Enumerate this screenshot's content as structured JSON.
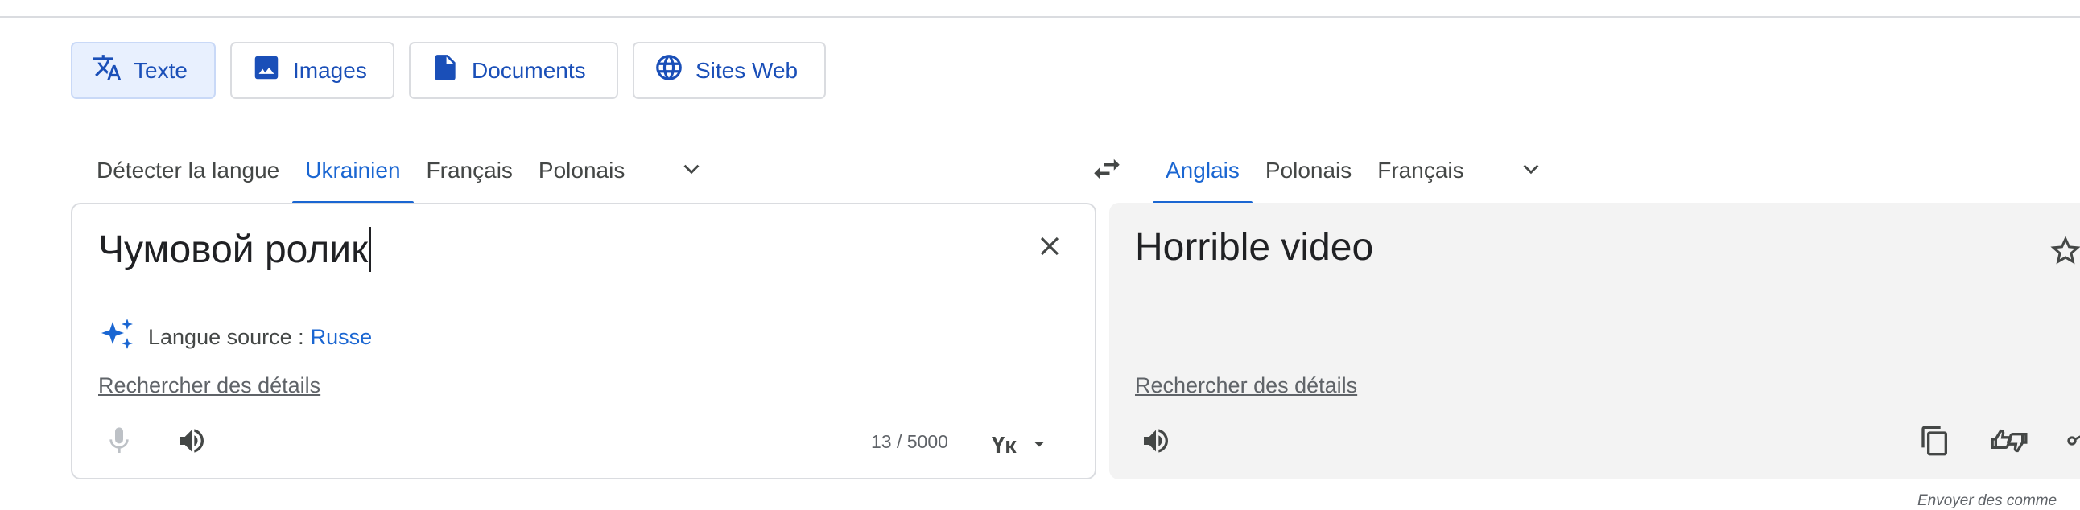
{
  "mode_tabs": {
    "text": "Texte",
    "images": "Images",
    "documents": "Documents",
    "websites": "Sites Web"
  },
  "source_langs": {
    "detect": "Détecter la langue",
    "items": [
      "Ukrainien",
      "Français",
      "Polonais"
    ],
    "active": "Ukrainien"
  },
  "target_langs": {
    "items": [
      "Anglais",
      "Polonais",
      "Français"
    ],
    "active": "Anglais"
  },
  "source": {
    "text": "Чумовой ролик",
    "detected_label": "Langue source :",
    "detected_lang": "Russe",
    "details_link": "Rechercher des détails",
    "char_count": "13 / 5000",
    "keyboard_label": "Үк"
  },
  "target": {
    "text": "Horrible video",
    "details_link": "Rechercher des détails"
  },
  "footer": {
    "feedback": "Envoyer des comme"
  },
  "colors": {
    "accent": "#1a66d2",
    "active_mode_bg": "#e8f0fe",
    "target_panel_bg": "#f3f3f3"
  }
}
